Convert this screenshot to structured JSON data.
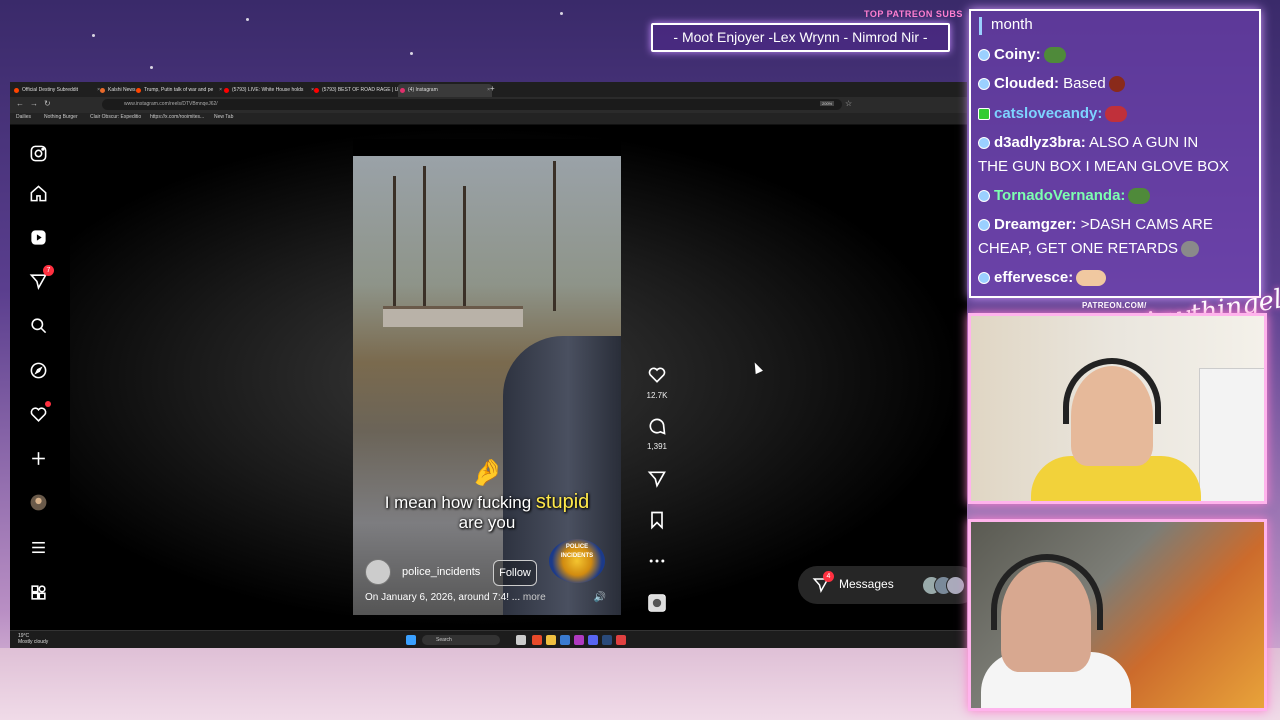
{
  "overlay": {
    "top_label": "TOP PATREON SUBS",
    "subs_ticker": "- Moot Enjoyer -Lex Wrynn - Nimrod Nir -",
    "patreon_label": "PATREON.COM/",
    "signature": "Anythingelse"
  },
  "browser": {
    "tabs": [
      {
        "label": "Official Destiny Subreddit",
        "color": "#ff4500"
      },
      {
        "label": "Kalshi News",
        "color": "#e86a2c"
      },
      {
        "label": "Trump, Putin talk of war and pe",
        "color": "#ff4500"
      },
      {
        "label": "(5793) LIVE: White House holds",
        "color": "#ff0000"
      },
      {
        "label": "(5793) BEST OF ROAD RAGE | U",
        "color": "#ff0000"
      },
      {
        "label": "(4) Instagram",
        "color": "#e1306c"
      }
    ],
    "url": "www.instagram.com/reels/DTVBmnqeJ62/",
    "zoom": "200%",
    "bookmarks": [
      "Dailies",
      "Nothing Burger",
      "Clair Obscur: Expeditio",
      "https://x.com/rooimites...",
      "New Tab"
    ]
  },
  "instagram": {
    "sidebar": [
      {
        "name": "instagram-logo-icon"
      },
      {
        "name": "home-icon"
      },
      {
        "name": "reels-icon"
      },
      {
        "name": "direct-messages-icon",
        "badge": "7"
      },
      {
        "name": "search-icon"
      },
      {
        "name": "explore-icon"
      },
      {
        "name": "notifications-icon",
        "dot": true
      },
      {
        "name": "create-icon"
      },
      {
        "name": "profile-avatar"
      },
      {
        "name": "menu-icon"
      },
      {
        "name": "more-apps-icon"
      }
    ],
    "reel": {
      "caption_line1_a": "I mean how fucking ",
      "caption_line1_b": "stupid",
      "caption_line2": "are you",
      "author": "police_incidents",
      "follow_label": "Follow",
      "description": "On January 6, 2026, around 7:4! ...",
      "more_label": "more",
      "logo_text": "POLICE INCIDENTS"
    },
    "actions": {
      "likes": "12.7K",
      "comments": "1,391"
    },
    "messages": {
      "label": "Messages",
      "badge": "4"
    }
  },
  "taskbar": {
    "weather_temp": "19°C",
    "weather_desc": "Mostly cloudy",
    "search_placeholder": "Search"
  },
  "chat": {
    "lines": [
      {
        "user": "",
        "text": "month",
        "user_color": "#ffffff"
      },
      {
        "user": "Coiny:",
        "text": "",
        "user_color": "#ffffff",
        "emote": "#4f8a3a"
      },
      {
        "user": "Clouded:",
        "text": "Based",
        "user_color": "#ffffff",
        "emote": "#8a2a1a"
      },
      {
        "user": "catslovecandy:",
        "text": "",
        "user_color": "#7dd3ff",
        "emote": "#c0303a"
      },
      {
        "user": "d3adlyz3bra:",
        "text": "ALSO A GUN IN",
        "user_color": "#ffffff"
      },
      {
        "user": "",
        "text": "THE GUN BOX I MEAN GLOVE BOX",
        "user_color": "#ffffff"
      },
      {
        "user": "TornadoVernanda:",
        "text": "",
        "user_color": "#7dffb0",
        "emote": "#4f8a3a"
      },
      {
        "user": "Dreamgzer:",
        "text": ">DASH CAMS ARE",
        "user_color": "#ffffff"
      },
      {
        "user": "",
        "text": "CHEAP, GET ONE RETARDS",
        "user_color": "#ffffff",
        "emote": "#8a8a8a"
      },
      {
        "user": "effervesce:",
        "text": "",
        "user_color": "#ffffff",
        "emote": "#f0c8a0"
      }
    ]
  }
}
